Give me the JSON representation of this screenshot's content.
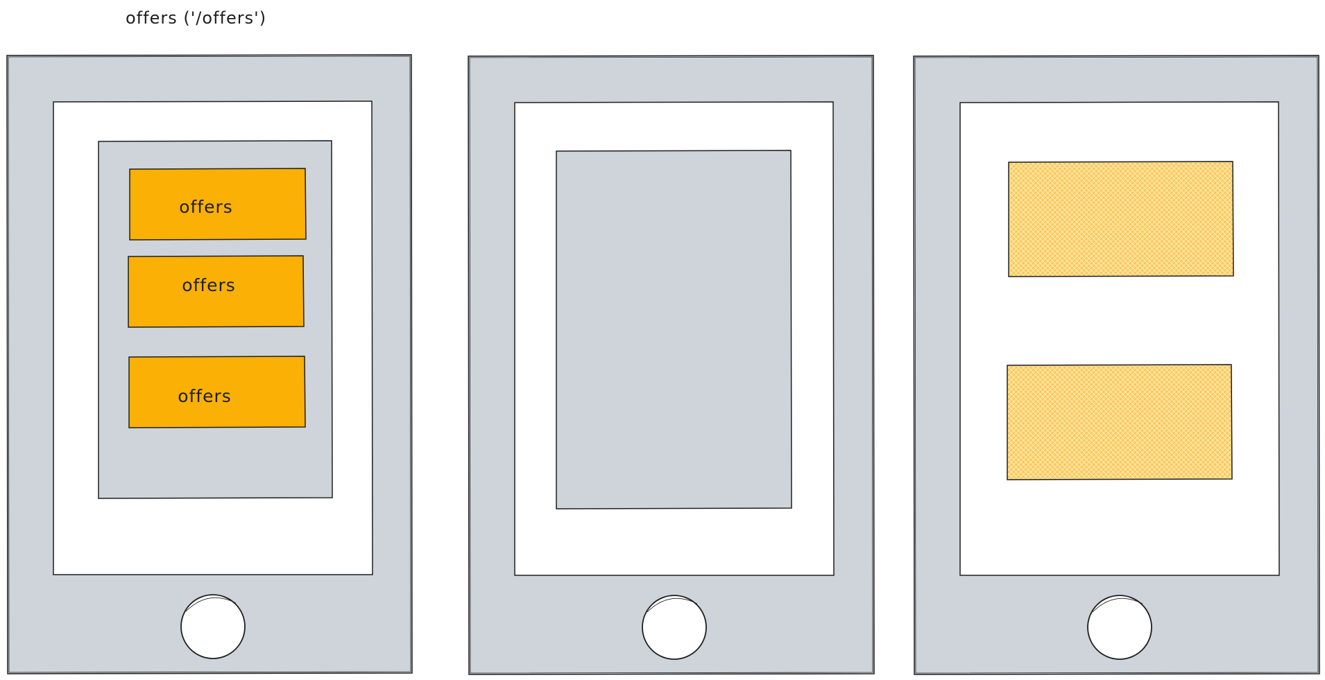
{
  "caption": "offers ('/offers')",
  "colors": {
    "device_frame": "#ced4da",
    "screen": "#ffffff",
    "panel": "#ced4da",
    "accent": "#fab005",
    "hatch_fill": "#ffd87a",
    "stroke": "#1e1e1e"
  },
  "devices": [
    {
      "panel": "list-panel",
      "cards": [
        {
          "label": "offers"
        },
        {
          "label": "offers"
        },
        {
          "label": "offers"
        }
      ]
    },
    {
      "panel": "empty-panel",
      "cards": []
    },
    {
      "panel": "none",
      "cards": [
        {
          "label": "",
          "style": "hatched"
        },
        {
          "label": "",
          "style": "hatched"
        }
      ]
    }
  ],
  "icons": [
    "home-button-icon"
  ]
}
